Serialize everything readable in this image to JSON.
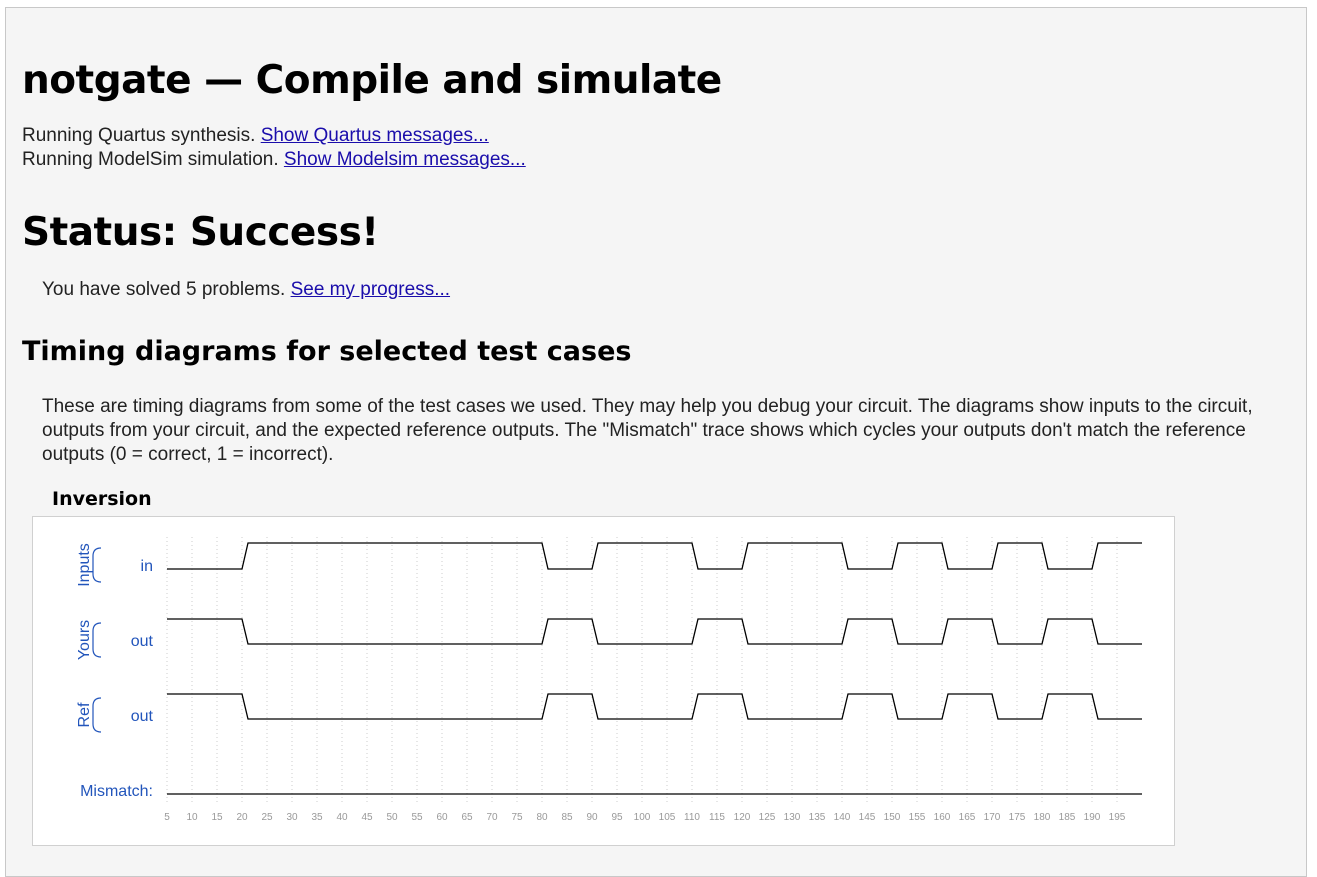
{
  "page_title": "notgate — Compile and simulate",
  "run": {
    "quartus_text": "Running Quartus synthesis.",
    "quartus_link": "Show Quartus messages...",
    "modelsim_text": "Running ModelSim simulation.",
    "modelsim_link": "Show Modelsim messages..."
  },
  "status": "Status: Success!",
  "progress": {
    "text": "You have solved 5 problems.",
    "link": "See my progress..."
  },
  "section_title": "Timing diagrams for selected test cases",
  "description": "These are timing diagrams from some of the test cases we used. They may help you debug your circuit. The diagrams show inputs to the circuit, outputs from your circuit, and the expected reference outputs. The \"Mismatch\" trace shows which cycles your outputs don't match the reference outputs (0 = correct, 1 = incorrect).",
  "diagram": {
    "title": "Inversion",
    "group_inputs": "Inputs",
    "group_yours": "Yours",
    "group_ref": "Ref",
    "signal_in": "in",
    "signal_yours_out": "out",
    "signal_ref_out": "out",
    "mismatch_label": "Mismatch:",
    "colors": {
      "label": "#2255bb",
      "trace": "#000000",
      "grid": "#cccccc",
      "tick": "#999999"
    }
  },
  "chart_data": {
    "type": "timing",
    "time_ticks": [
      5,
      10,
      15,
      20,
      25,
      30,
      35,
      40,
      45,
      50,
      55,
      60,
      65,
      70,
      75,
      80,
      85,
      90,
      95,
      100,
      105,
      110,
      115,
      120,
      125,
      130,
      135,
      140,
      145,
      150,
      155,
      160,
      165,
      170,
      175,
      180,
      185,
      190,
      195
    ],
    "time_range": [
      5,
      200
    ],
    "signals": [
      {
        "group": "Inputs",
        "name": "in",
        "transitions": [
          [
            5,
            0
          ],
          [
            20,
            1
          ],
          [
            80,
            0
          ],
          [
            90,
            1
          ],
          [
            110,
            0
          ],
          [
            120,
            1
          ],
          [
            140,
            0
          ],
          [
            150,
            1
          ],
          [
            160,
            0
          ],
          [
            170,
            1
          ],
          [
            180,
            0
          ],
          [
            190,
            1
          ]
        ]
      },
      {
        "group": "Yours",
        "name": "out",
        "transitions": [
          [
            5,
            1
          ],
          [
            20,
            0
          ],
          [
            80,
            1
          ],
          [
            90,
            0
          ],
          [
            110,
            1
          ],
          [
            120,
            0
          ],
          [
            140,
            1
          ],
          [
            150,
            0
          ],
          [
            160,
            1
          ],
          [
            170,
            0
          ],
          [
            180,
            1
          ],
          [
            190,
            0
          ]
        ]
      },
      {
        "group": "Ref",
        "name": "out",
        "transitions": [
          [
            5,
            1
          ],
          [
            20,
            0
          ],
          [
            80,
            1
          ],
          [
            90,
            0
          ],
          [
            110,
            1
          ],
          [
            120,
            0
          ],
          [
            140,
            1
          ],
          [
            150,
            0
          ],
          [
            160,
            1
          ],
          [
            170,
            0
          ],
          [
            180,
            1
          ],
          [
            190,
            0
          ]
        ]
      },
      {
        "group": "",
        "name": "Mismatch:",
        "transitions": [
          [
            5,
            0
          ]
        ]
      }
    ]
  }
}
